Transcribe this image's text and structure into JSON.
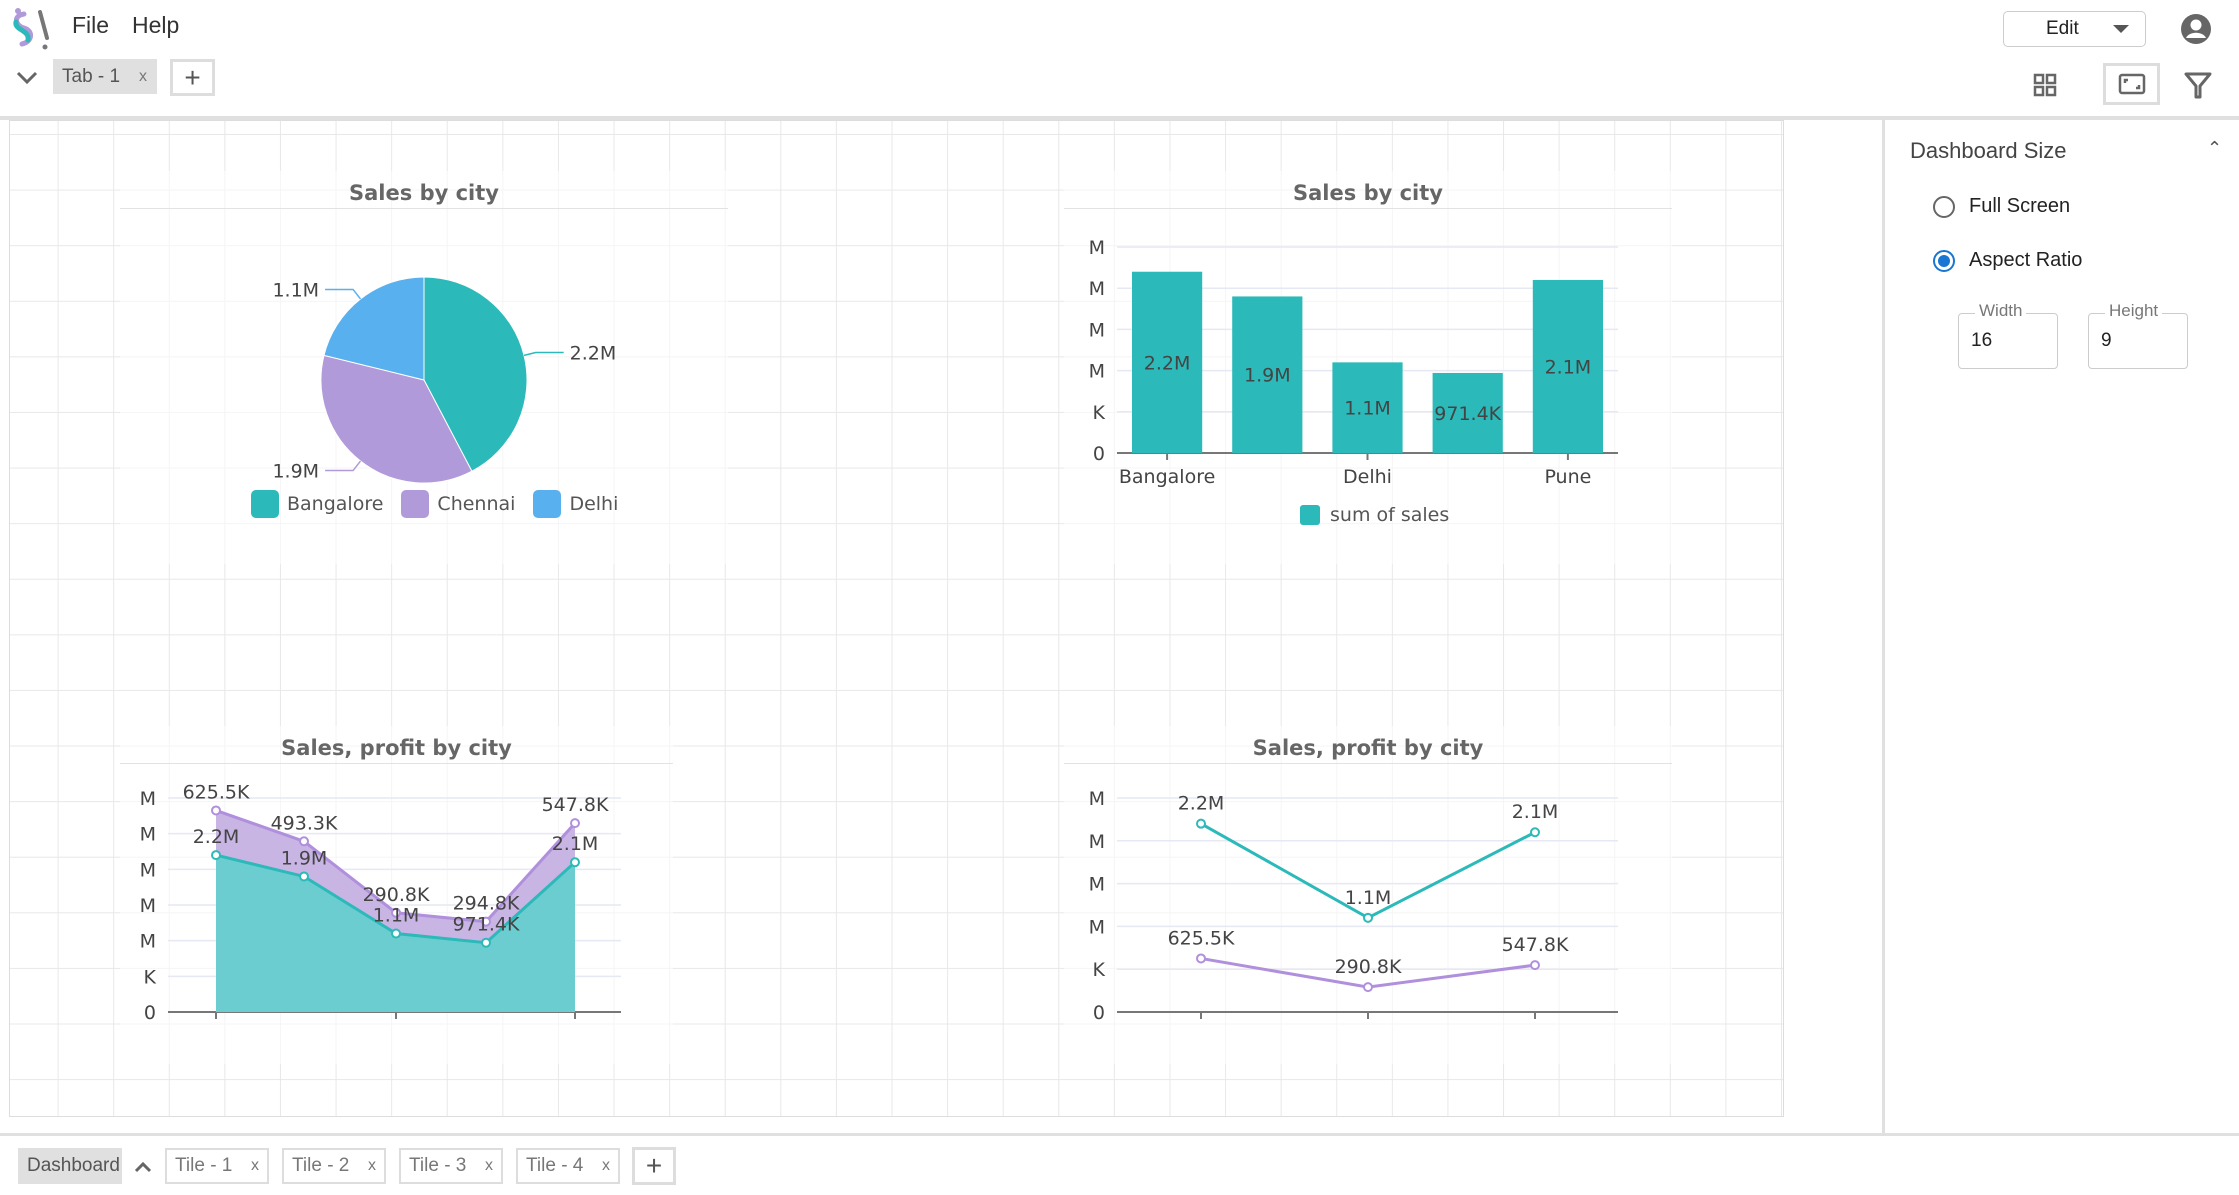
{
  "menu": {
    "file": "File",
    "help": "Help"
  },
  "tabs": [
    {
      "label": "Tab - 1",
      "close": "x"
    }
  ],
  "toolbar": {
    "edit_label": "Edit",
    "icons": [
      "grid-icon",
      "aspect-ratio-icon",
      "filter-icon",
      "account-icon"
    ]
  },
  "panel": {
    "title": "Dashboard Size",
    "options": [
      {
        "label": "Full Screen",
        "selected": false
      },
      {
        "label": "Aspect Ratio",
        "selected": true
      }
    ],
    "width_label": "Width",
    "width_value": "16",
    "height_label": "Height",
    "height_value": "9"
  },
  "bottom": {
    "dashboard": "Dashboard",
    "tiles": [
      {
        "label": "Tile - 1",
        "close": "x"
      },
      {
        "label": "Tile - 2",
        "close": "x"
      },
      {
        "label": "Tile - 3",
        "close": "x"
      },
      {
        "label": "Tile - 4",
        "close": "x"
      }
    ]
  },
  "colors": {
    "teal": "#2cb9b9",
    "purple": "#b09ad9",
    "blue": "#58b0ee",
    "accent": "#1976d2"
  },
  "chart_data": [
    {
      "type": "pie",
      "title": "Sales by city",
      "categories": [
        "Bangalore",
        "Chennai",
        "Delhi"
      ],
      "values": [
        2200000,
        1900000,
        1100000
      ],
      "labels": [
        "2.2M",
        "1.9M",
        "1.1M"
      ],
      "legend": "bottom"
    },
    {
      "type": "bar",
      "title": "Sales by city",
      "categories": [
        "Bangalore",
        "",
        "Delhi",
        "",
        "Pune"
      ],
      "values": [
        2200000,
        1900000,
        1100000,
        971400,
        2100000
      ],
      "labels": [
        "2.2M",
        "1.9M",
        "1.1M",
        "971.4K",
        "2.1M"
      ],
      "yticks": [
        "0",
        "K",
        "M",
        "M",
        "M",
        "M"
      ],
      "ylim": [
        0,
        2500000
      ],
      "grid": true,
      "series": [
        {
          "name": "sum of sales"
        }
      ],
      "legend": "bottom"
    },
    {
      "type": "area",
      "title": "Sales, profit by city",
      "stacked": true,
      "ylim": [
        0,
        3000000
      ],
      "yticks": [
        "0",
        "K",
        "M",
        "M",
        "M",
        "M",
        "M"
      ],
      "grid": true,
      "series": [
        {
          "values": [
            2200000,
            1900000,
            1100000,
            971400,
            2100000
          ],
          "labels": [
            "2.2M",
            "1.9M",
            "1.1M",
            "971.4K",
            "2.1M"
          ]
        },
        {
          "values": [
            625500,
            493300,
            290800,
            294800,
            547800
          ],
          "labels": [
            "625.5K",
            "493.3K",
            "290.8K",
            "294.8K",
            "547.8K"
          ]
        }
      ]
    },
    {
      "type": "line",
      "title": "Sales, profit by city",
      "ylim": [
        0,
        2500000
      ],
      "yticks": [
        "0",
        "K",
        "M",
        "M",
        "M",
        "M"
      ],
      "grid": true,
      "series": [
        {
          "values": [
            2200000,
            1100000,
            2100000
          ],
          "labels": [
            "2.2M",
            "1.1M",
            "2.1M"
          ]
        },
        {
          "values": [
            625500,
            290800,
            547800
          ],
          "labels": [
            "625.5K",
            "290.8K",
            "547.8K"
          ]
        }
      ]
    }
  ]
}
